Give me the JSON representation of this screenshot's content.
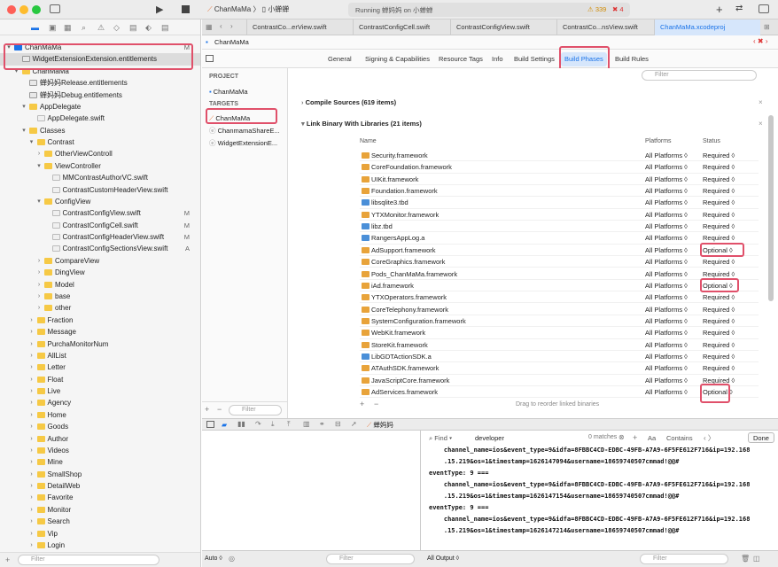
{
  "window": {
    "scheme": "ChanMaMa",
    "device": "小蝉蝉",
    "status": "Running 蝉妈妈 on 小蝉蝉",
    "warnings": "339",
    "errors": "4"
  },
  "tabs": [
    "ContrastCo...erView.swift",
    "ContrastConfigCell.swift",
    "ContrastConfigView.swift",
    "ContrastCo...nsView.swift",
    "ChanMaMa.xcodeproj"
  ],
  "navigator": {
    "rows": [
      {
        "label": "ChanMaMa",
        "badge": "M",
        "indent": 0,
        "arrow": "▾",
        "icon": "project"
      },
      {
        "label": "WidgetExtensionExtension.entitlements",
        "badge": "",
        "indent": 1,
        "arrow": "",
        "icon": "ent"
      },
      {
        "label": "ChanMaMa",
        "badge": "",
        "indent": 1,
        "arrow": "▾",
        "icon": "folder"
      },
      {
        "label": "蝉妈妈Release.entitlements",
        "badge": "",
        "indent": 2,
        "arrow": "",
        "icon": "ent"
      },
      {
        "label": "蝉妈妈Debug.entitlements",
        "badge": "",
        "indent": 2,
        "arrow": "",
        "icon": "ent"
      },
      {
        "label": "AppDelegate",
        "badge": "",
        "indent": 2,
        "arrow": "▾",
        "icon": "folder"
      },
      {
        "label": "AppDelegate.swift",
        "badge": "",
        "indent": 3,
        "arrow": "",
        "icon": "swift"
      },
      {
        "label": "Classes",
        "badge": "",
        "indent": 2,
        "arrow": "▾",
        "icon": "folder"
      },
      {
        "label": "Contrast",
        "badge": "",
        "indent": 3,
        "arrow": "▾",
        "icon": "folder"
      },
      {
        "label": "OtherViewControll",
        "badge": "",
        "indent": 4,
        "arrow": "›",
        "icon": "folder"
      },
      {
        "label": "ViewController",
        "badge": "",
        "indent": 4,
        "arrow": "▾",
        "icon": "folder"
      },
      {
        "label": "MMContrastAuthorVC.swift",
        "badge": "",
        "indent": 5,
        "arrow": "",
        "icon": "swift"
      },
      {
        "label": "ContrastCustomHeaderView.swift",
        "badge": "",
        "indent": 5,
        "arrow": "",
        "icon": "swift"
      },
      {
        "label": "ConfigView",
        "badge": "",
        "indent": 4,
        "arrow": "▾",
        "icon": "folder"
      },
      {
        "label": "ContrastConfigView.swift",
        "badge": "M",
        "indent": 5,
        "arrow": "",
        "icon": "swift"
      },
      {
        "label": "ContrastConfigCell.swift",
        "badge": "M",
        "indent": 5,
        "arrow": "",
        "icon": "swift"
      },
      {
        "label": "ContrastConfigHeaderView.swift",
        "badge": "M",
        "indent": 5,
        "arrow": "",
        "icon": "swift"
      },
      {
        "label": "ContrastConfigSectionsView.swift",
        "badge": "A",
        "indent": 5,
        "arrow": "",
        "icon": "swift"
      },
      {
        "label": "CompareView",
        "badge": "",
        "indent": 4,
        "arrow": "›",
        "icon": "folder"
      },
      {
        "label": "DingView",
        "badge": "",
        "indent": 4,
        "arrow": "›",
        "icon": "folder"
      },
      {
        "label": "Model",
        "badge": "",
        "indent": 4,
        "arrow": "›",
        "icon": "folder"
      },
      {
        "label": "base",
        "badge": "",
        "indent": 4,
        "arrow": "›",
        "icon": "folder"
      },
      {
        "label": "other",
        "badge": "",
        "indent": 4,
        "arrow": "›",
        "icon": "folder"
      },
      {
        "label": "Fraction",
        "badge": "",
        "indent": 3,
        "arrow": "›",
        "icon": "folder"
      },
      {
        "label": "Message",
        "badge": "",
        "indent": 3,
        "arrow": "›",
        "icon": "folder"
      },
      {
        "label": "PurchaMonitorNum",
        "badge": "",
        "indent": 3,
        "arrow": "›",
        "icon": "folder"
      },
      {
        "label": "AllList",
        "badge": "",
        "indent": 3,
        "arrow": "›",
        "icon": "folder"
      },
      {
        "label": "Letter",
        "badge": "",
        "indent": 3,
        "arrow": "›",
        "icon": "folder"
      },
      {
        "label": "Float",
        "badge": "",
        "indent": 3,
        "arrow": "›",
        "icon": "folder"
      },
      {
        "label": "Live",
        "badge": "",
        "indent": 3,
        "arrow": "›",
        "icon": "folder"
      },
      {
        "label": "Agency",
        "badge": "",
        "indent": 3,
        "arrow": "›",
        "icon": "folder"
      },
      {
        "label": "Home",
        "badge": "",
        "indent": 3,
        "arrow": "›",
        "icon": "folder"
      },
      {
        "label": "Goods",
        "badge": "",
        "indent": 3,
        "arrow": "›",
        "icon": "folder"
      },
      {
        "label": "Author",
        "badge": "",
        "indent": 3,
        "arrow": "›",
        "icon": "folder"
      },
      {
        "label": "Videos",
        "badge": "",
        "indent": 3,
        "arrow": "›",
        "icon": "folder"
      },
      {
        "label": "Mine",
        "badge": "",
        "indent": 3,
        "arrow": "›",
        "icon": "folder"
      },
      {
        "label": "SmallShop",
        "badge": "",
        "indent": 3,
        "arrow": "›",
        "icon": "folder"
      },
      {
        "label": "DetailWeb",
        "badge": "",
        "indent": 3,
        "arrow": "›",
        "icon": "folder"
      },
      {
        "label": "Favorite",
        "badge": "",
        "indent": 3,
        "arrow": "›",
        "icon": "folder"
      },
      {
        "label": "Monitor",
        "badge": "",
        "indent": 3,
        "arrow": "›",
        "icon": "folder"
      },
      {
        "label": "Search",
        "badge": "",
        "indent": 3,
        "arrow": "›",
        "icon": "folder"
      },
      {
        "label": "Vip",
        "badge": "",
        "indent": 3,
        "arrow": "›",
        "icon": "folder"
      },
      {
        "label": "Login",
        "badge": "",
        "indent": 3,
        "arrow": "›",
        "icon": "folder"
      }
    ],
    "filter_placeholder": "Filter"
  },
  "editor": {
    "breadcrumb": "ChanMaMa",
    "settings_tabs": [
      "General",
      "Signing & Capabilities",
      "Resource Tags",
      "Info",
      "Build Settings",
      "Build Phases",
      "Build Rules"
    ],
    "project_header": "PROJECT",
    "project_item": "ChanMaMa",
    "targets_header": "TARGETS",
    "targets": [
      "ChanMaMa",
      "ChanmamaShareE...",
      "WidgetExtensionE..."
    ],
    "filter_placeholder": "Filter",
    "compile_sources": "Compile Sources (619 items)",
    "link_binary": "Link Binary With Libraries (21 items)",
    "col_name": "Name",
    "col_platforms": "Platforms",
    "col_status": "Status",
    "libraries": [
      {
        "name": "Security.framework",
        "platform": "All Platforms ◊",
        "status": "Required ◊"
      },
      {
        "name": "CoreFoundation.framework",
        "platform": "All Platforms ◊",
        "status": "Required ◊"
      },
      {
        "name": "UIKit.framework",
        "platform": "All Platforms ◊",
        "status": "Required ◊"
      },
      {
        "name": "Foundation.framework",
        "platform": "All Platforms ◊",
        "status": "Required ◊"
      },
      {
        "name": "libsqlite3.tbd",
        "platform": "All Platforms ◊",
        "status": "Required ◊"
      },
      {
        "name": "YTXMonitor.framework",
        "platform": "All Platforms ◊",
        "status": "Required ◊"
      },
      {
        "name": "libz.tbd",
        "platform": "All Platforms ◊",
        "status": "Required ◊"
      },
      {
        "name": "RangersAppLog.a",
        "platform": "All Platforms ◊",
        "status": "Required ◊"
      },
      {
        "name": "AdSupport.framework",
        "platform": "All Platforms ◊",
        "status": "Optional ◊"
      },
      {
        "name": "CoreGraphics.framework",
        "platform": "All Platforms ◊",
        "status": "Required ◊"
      },
      {
        "name": "Pods_ChanMaMa.framework",
        "platform": "All Platforms ◊",
        "status": "Required ◊"
      },
      {
        "name": "iAd.framework",
        "platform": "All Platforms ◊",
        "status": "Optional ◊"
      },
      {
        "name": "YTXOperators.framework",
        "platform": "All Platforms ◊",
        "status": "Required ◊"
      },
      {
        "name": "CoreTelephony.framework",
        "platform": "All Platforms ◊",
        "status": "Required ◊"
      },
      {
        "name": "SystemConfiguration.framework",
        "platform": "All Platforms ◊",
        "status": "Required ◊"
      },
      {
        "name": "WebKit.framework",
        "platform": "All Platforms ◊",
        "status": "Required ◊"
      },
      {
        "name": "StoreKit.framework",
        "platform": "All Platforms ◊",
        "status": "Required ◊"
      },
      {
        "name": "LibGDTActionSDK.a",
        "platform": "All Platforms ◊",
        "status": "Required ◊"
      },
      {
        "name": "ATAuthSDK.framework",
        "platform": "All Platforms ◊",
        "status": "Required ◊"
      },
      {
        "name": "JavaScriptCore.framework",
        "platform": "All Platforms ◊",
        "status": "Required ◊"
      },
      {
        "name": "AdServices.framework",
        "platform": "All Platforms ◊",
        "status": "Optional ◊"
      }
    ],
    "drag_hint": "Drag to reorder linked binaries",
    "add_label": "+",
    "remove_label": "−"
  },
  "debug": {
    "process": "蝉妈妈",
    "find_label": "Find",
    "find_value": "developer",
    "matches": "0 matches",
    "aa": "Aa",
    "contains": "Contains",
    "done": "Done",
    "console_lines": [
      "    channel_name=ios&event_type=9&idfa=8FBBC4CD-EDBC-49FB-A7A9-6F5FE612F716&ip=192.168",
      "    .15.219&os=1&timestamp=1626147094&username=18659740507cmmad!@@#",
      "eventType: 9 ===",
      "    channel_name=ios&event_type=9&idfa=8FBBC4CD-EDBC-49FB-A7A9-6F5FE612F716&ip=192.168",
      "    .15.219&os=1&timestamp=1626147154&username=18659740507cmmad!@@#",
      "eventType: 9 ===",
      "    channel_name=ios&event_type=9&idfa=8FBBC4CD-EDBC-49FB-A7A9-6F5FE612F716&ip=192.168",
      "    .15.219&os=1&timestamp=1626147214&username=18659740507cmmad!@@#"
    ],
    "auto_label": "Auto ◊",
    "filter_placeholder": "Filter",
    "output_label": "All Output ◊"
  },
  "colors": {
    "accent": "#1a73e8",
    "highlight": "#e0506a",
    "folder": "#f6c945"
  }
}
